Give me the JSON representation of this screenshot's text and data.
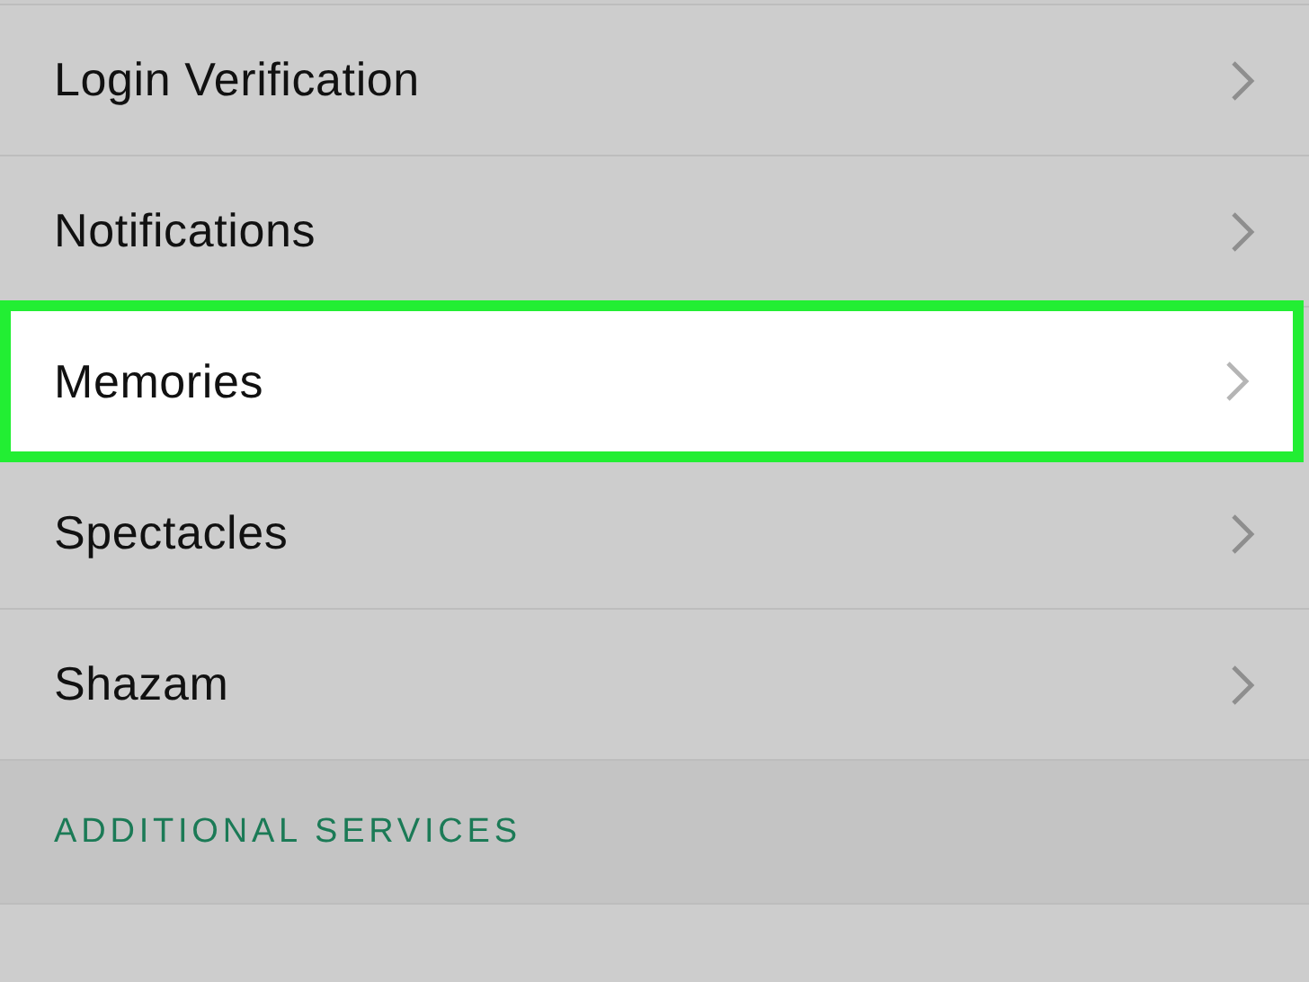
{
  "settings_list": [
    {
      "kind": "row",
      "label": "Login Verification",
      "selected": false
    },
    {
      "kind": "row",
      "label": "Notifications",
      "selected": false
    },
    {
      "kind": "row",
      "label": "Memories",
      "selected": true
    },
    {
      "kind": "row",
      "label": "Spectacles",
      "selected": false
    },
    {
      "kind": "row",
      "label": "Shazam",
      "selected": false
    },
    {
      "kind": "section",
      "label": "ADDITIONAL SERVICES"
    },
    {
      "kind": "partial_row"
    }
  ]
}
